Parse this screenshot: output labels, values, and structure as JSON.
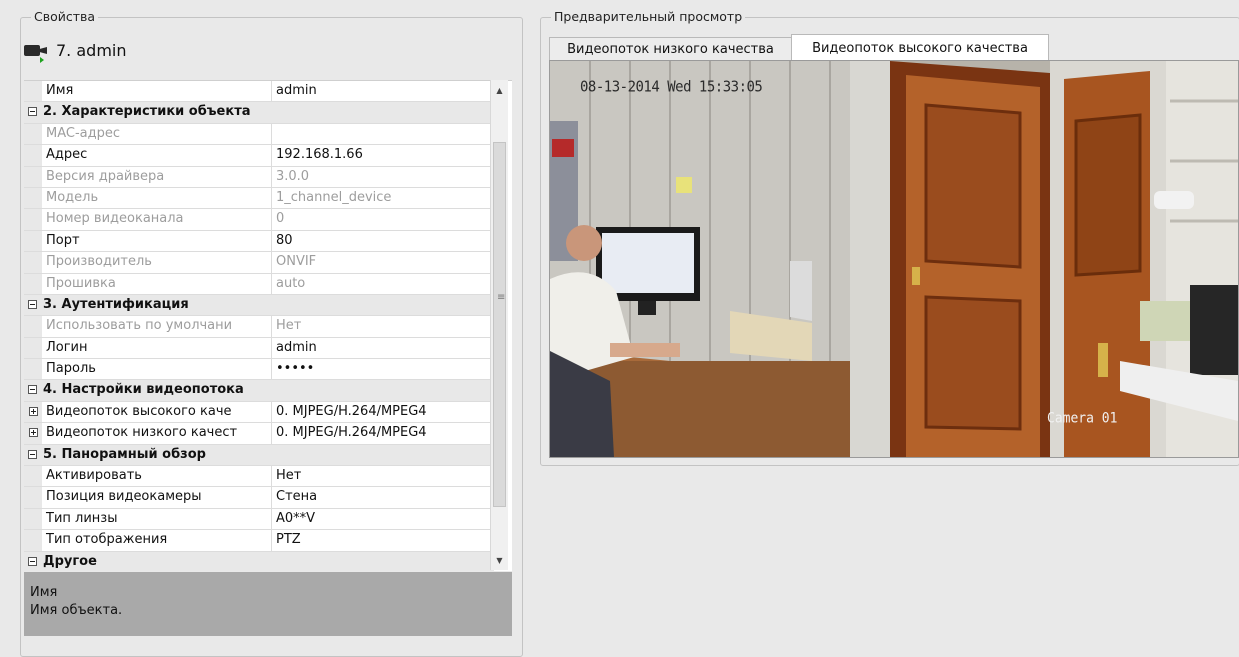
{
  "properties_panel": {
    "title": "Свойства",
    "object_name": "7. admin",
    "rows": [
      {
        "kind": "prop",
        "name": "Имя",
        "value": "admin",
        "disabled": false
      },
      {
        "kind": "cat",
        "label": "2. Характеристики объекта",
        "toggle": "minus"
      },
      {
        "kind": "prop",
        "name": "MAC-адрес",
        "value": "",
        "disabled": true
      },
      {
        "kind": "prop",
        "name": "Адрес",
        "value": "192.168.1.66",
        "disabled": false
      },
      {
        "kind": "prop",
        "name": "Версия драйвера",
        "value": "3.0.0",
        "disabled": true
      },
      {
        "kind": "prop",
        "name": "Модель",
        "value": "1_channel_device",
        "disabled": true
      },
      {
        "kind": "prop",
        "name": "Номер видеоканала",
        "value": "0",
        "disabled": true
      },
      {
        "kind": "prop",
        "name": "Порт",
        "value": "80",
        "disabled": false
      },
      {
        "kind": "prop",
        "name": "Производитель",
        "value": "ONVIF",
        "disabled": true
      },
      {
        "kind": "prop",
        "name": "Прошивка",
        "value": "auto",
        "disabled": true
      },
      {
        "kind": "cat",
        "label": "3. Аутентификация",
        "toggle": "minus"
      },
      {
        "kind": "prop",
        "name": "Использовать по умолчани",
        "value": "Нет",
        "disabled": true
      },
      {
        "kind": "prop",
        "name": "Логин",
        "value": "admin",
        "disabled": false
      },
      {
        "kind": "prop",
        "name": "Пароль",
        "value": "•••••",
        "disabled": false
      },
      {
        "kind": "cat",
        "label": "4. Настройки видеопотока",
        "toggle": "minus"
      },
      {
        "kind": "sub",
        "name": "Видеопоток высокого каче",
        "value": "0. MJPEG/H.264/MPEG4",
        "toggle": "plus"
      },
      {
        "kind": "sub",
        "name": "Видеопоток низкого качест",
        "value": "0. MJPEG/H.264/MPEG4",
        "toggle": "plus"
      },
      {
        "kind": "cat",
        "label": "5. Панорамный обзор",
        "toggle": "minus"
      },
      {
        "kind": "prop",
        "name": "Активировать",
        "value": "Нет",
        "disabled": false
      },
      {
        "kind": "prop",
        "name": "Позиция видеокамеры",
        "value": "Стена",
        "disabled": false
      },
      {
        "kind": "prop",
        "name": "Тип линзы",
        "value": "A0**V",
        "disabled": false
      },
      {
        "kind": "prop",
        "name": "Тип отображения",
        "value": "PTZ",
        "disabled": false
      },
      {
        "kind": "cat",
        "label": "Другое",
        "toggle": "minus"
      }
    ],
    "description": {
      "title": "Имя",
      "text": "Имя объекта."
    }
  },
  "preview_panel": {
    "title": "Предварительный просмотр",
    "tabs": [
      {
        "label": "Видеопоток низкого качества",
        "selected": false
      },
      {
        "label": "Видеопоток высокого качества",
        "selected": true
      }
    ],
    "overlay_timestamp": "08-13-2014 Wed 15:33:05",
    "overlay_camera": "Camera 01"
  },
  "colors": {
    "window_bg": "#e9e9e9",
    "grid_gutter": "#e8e8e8",
    "disabled_text": "#9d9d9d",
    "description_bg": "#a9a9a9"
  }
}
